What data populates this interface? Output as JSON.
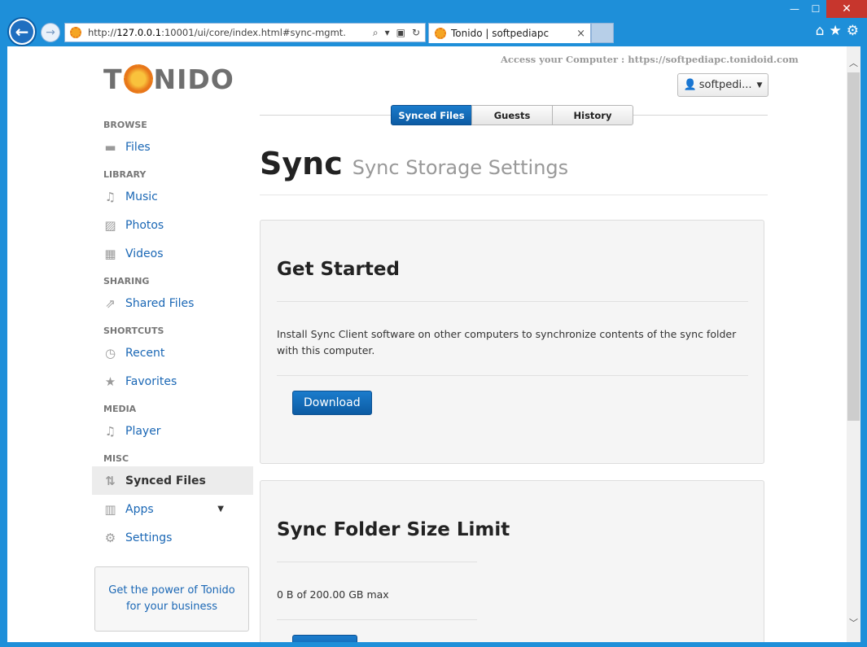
{
  "browser": {
    "url_prefix": "http://",
    "url_host": "127.0.0.1",
    "url_rest": ":10001/ui/core/index.html#sync-mgmt.",
    "tab_title": "Tonido | softpediapc",
    "tab_close": "×",
    "controls": {
      "minimize": "—",
      "maximize": "☐",
      "close": "✕"
    },
    "icons": {
      "home": "⌂",
      "favorites": "★",
      "settings": "⚙"
    }
  },
  "header": {
    "logo_left": "T",
    "logo_right": "NIDO",
    "access_text": "Access your Computer : https://softpediapc.tonidoid.com",
    "user_label": "softpedi..."
  },
  "tabs": [
    {
      "label": "Synced Files",
      "active": true
    },
    {
      "label": "Guests"
    },
    {
      "label": "History"
    }
  ],
  "page": {
    "title": "Sync",
    "subtitle": "Sync Storage Settings"
  },
  "sidebar": {
    "browse": "BROWSE",
    "files": "Files",
    "library": "LIBRARY",
    "music": "Music",
    "photos": "Photos",
    "videos": "Videos",
    "sharing": "SHARING",
    "shared_files": "Shared Files",
    "shortcuts": "SHORTCUTS",
    "recent": "Recent",
    "favorites": "Favorites",
    "media": "MEDIA",
    "player": "Player",
    "misc": "MISC",
    "synced_files": "Synced Files",
    "apps": "Apps",
    "settings": "Settings",
    "promo": "Get the power of Tonido for your business"
  },
  "cards": {
    "get_started": {
      "title": "Get Started",
      "text": "Install Sync Client software on other computers to synchronize contents of the sync folder with this computer.",
      "button": "Download"
    },
    "size_limit": {
      "title": "Sync Folder Size Limit",
      "text": "0 B of 200.00 GB max"
    }
  }
}
